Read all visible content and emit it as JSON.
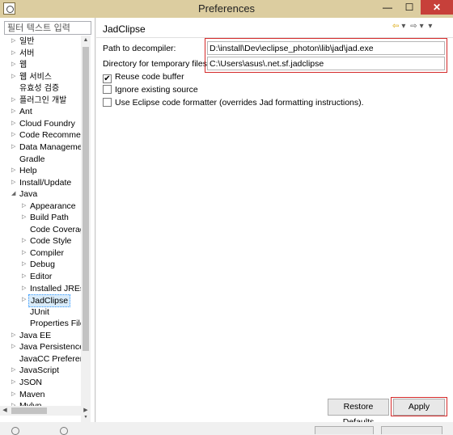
{
  "window": {
    "title": "Preferences"
  },
  "filter": {
    "placeholder": "필터 텍스트 입력"
  },
  "tree": [
    {
      "label": "일반",
      "arrow": "▷",
      "indent": 0,
      "ko": true
    },
    {
      "label": "서버",
      "arrow": "▷",
      "indent": 0,
      "ko": true
    },
    {
      "label": "웹",
      "arrow": "▷",
      "indent": 0,
      "ko": true
    },
    {
      "label": "웹 서비스",
      "arrow": "▷",
      "indent": 0,
      "ko": true
    },
    {
      "label": "유효성 검증",
      "arrow": "",
      "indent": 0,
      "ko": true
    },
    {
      "label": "플러그인 개발",
      "arrow": "▷",
      "indent": 0,
      "ko": true
    },
    {
      "label": "Ant",
      "arrow": "▷",
      "indent": 0
    },
    {
      "label": "Cloud Foundry",
      "arrow": "▷",
      "indent": 0
    },
    {
      "label": "Code Recommenders",
      "arrow": "▷",
      "indent": 0
    },
    {
      "label": "Data Management",
      "arrow": "▷",
      "indent": 0
    },
    {
      "label": "Gradle",
      "arrow": "",
      "indent": 0
    },
    {
      "label": "Help",
      "arrow": "▷",
      "indent": 0
    },
    {
      "label": "Install/Update",
      "arrow": "▷",
      "indent": 0
    },
    {
      "label": "Java",
      "arrow": "◢",
      "indent": 0
    },
    {
      "label": "Appearance",
      "arrow": "▷",
      "indent": 1
    },
    {
      "label": "Build Path",
      "arrow": "▷",
      "indent": 1
    },
    {
      "label": "Code Coverage",
      "arrow": "",
      "indent": 1
    },
    {
      "label": "Code Style",
      "arrow": "▷",
      "indent": 1
    },
    {
      "label": "Compiler",
      "arrow": "▷",
      "indent": 1
    },
    {
      "label": "Debug",
      "arrow": "▷",
      "indent": 1
    },
    {
      "label": "Editor",
      "arrow": "▷",
      "indent": 1
    },
    {
      "label": "Installed JREs",
      "arrow": "▷",
      "indent": 1
    },
    {
      "label": "JadClipse",
      "arrow": "▷",
      "indent": 1,
      "selected": true
    },
    {
      "label": "JUnit",
      "arrow": "",
      "indent": 1
    },
    {
      "label": "Properties Files Editor",
      "arrow": "",
      "indent": 1
    },
    {
      "label": "Java EE",
      "arrow": "▷",
      "indent": 0
    },
    {
      "label": "Java Persistence",
      "arrow": "▷",
      "indent": 0
    },
    {
      "label": "JavaCC Preferences",
      "arrow": "",
      "indent": 0
    },
    {
      "label": "JavaScript",
      "arrow": "▷",
      "indent": 0
    },
    {
      "label": "JSON",
      "arrow": "▷",
      "indent": 0
    },
    {
      "label": "Maven",
      "arrow": "▷",
      "indent": 0
    },
    {
      "label": "Mylyn",
      "arrow": "▷",
      "indent": 0
    }
  ],
  "page": {
    "title": "JadClipse",
    "decompiler_label": "Path to decompiler:",
    "decompiler_value": "D:\\install\\Dev\\eclipse_photon\\lib\\jad\\jad.exe",
    "tempdir_label": "Directory for temporary files:",
    "tempdir_value": "C:\\Users\\asus\\.net.sf.jadclipse",
    "options": [
      {
        "label": "Reuse code buffer",
        "checked": true
      },
      {
        "label": "Ignore existing source",
        "checked": false
      },
      {
        "label": "Use Eclipse code formatter (overrides Jad formatting instructions).",
        "checked": false
      }
    ],
    "restore_label": "Restore Defaults",
    "apply_label": "Apply"
  },
  "colors": {
    "title_bar": "#dccda0",
    "highlight": "#d42a2a",
    "selection": "#d9ebf9"
  },
  "icons": [
    "back-arrow-icon",
    "forward-arrow-icon",
    "view-menu-icon"
  ]
}
